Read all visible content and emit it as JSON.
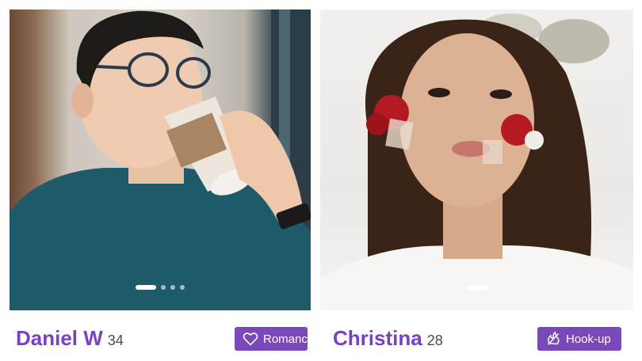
{
  "profiles": [
    {
      "name": "Daniel W",
      "age": "34",
      "tag": {
        "label": "Romance",
        "icon": "heart-outline-icon"
      },
      "photo_count": 4,
      "active_photo": 1
    },
    {
      "name": "Christina",
      "age": "28",
      "tag": {
        "label": "Hook-up",
        "icon": "flame-slash-icon"
      },
      "photo_count": 1,
      "active_photo": 1
    }
  ],
  "colors": {
    "accent": "#7a48b8",
    "name": "#7a3fc4"
  }
}
